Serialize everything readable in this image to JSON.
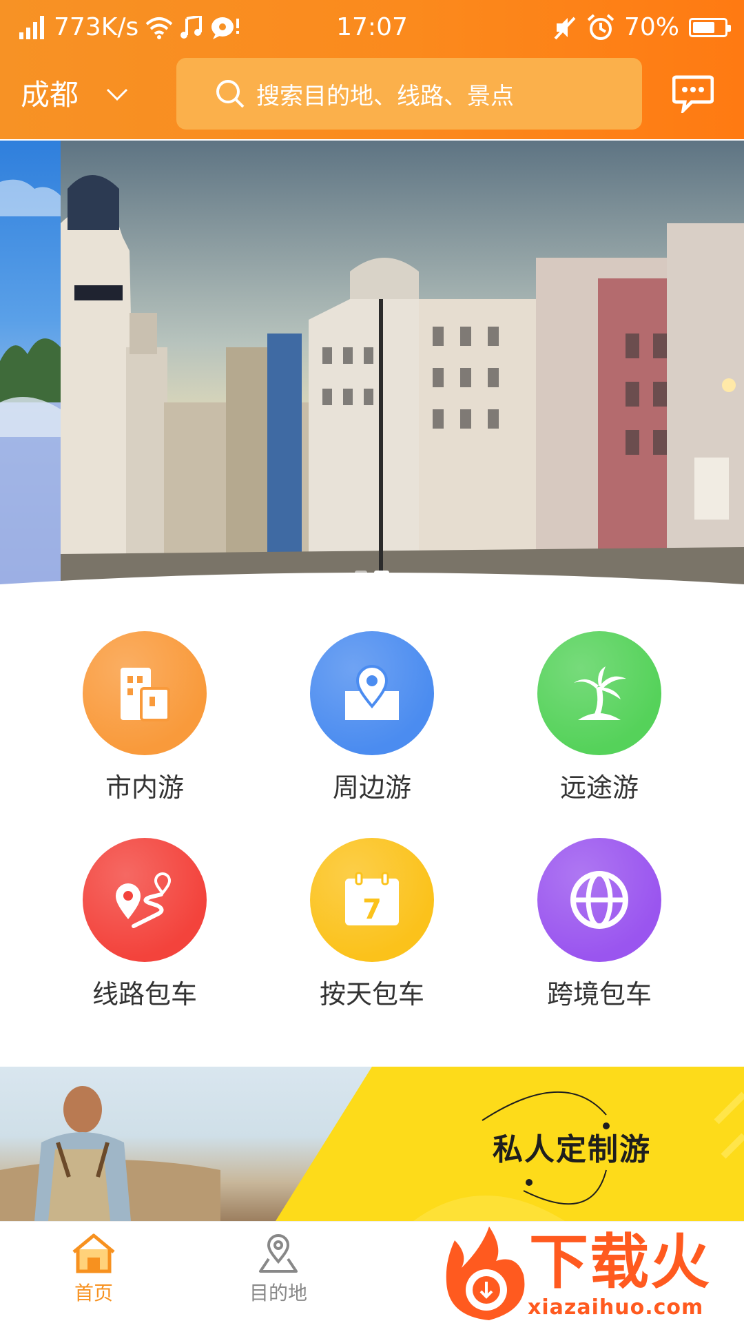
{
  "status_bar": {
    "net_speed": "773K/s",
    "time": "17:07",
    "battery": "70%",
    "battery_level": 0.7
  },
  "top_bar": {
    "city": "成都",
    "search_placeholder": "搜索目的地、线路、景点"
  },
  "banner": {
    "slide_count": 2,
    "active_slide": 1
  },
  "categories": [
    {
      "label": "市内游",
      "icon": "buildings-icon",
      "color": "#f99a3b"
    },
    {
      "label": "周边游",
      "icon": "map-pin-icon",
      "color": "#4b8cf0"
    },
    {
      "label": "远途游",
      "icon": "palm-tree-icon",
      "color": "#55d25a"
    },
    {
      "label": "线路包车",
      "icon": "route-icon",
      "color": "#f3433c"
    },
    {
      "label": "按天包车",
      "icon": "calendar-icon",
      "color": "#fbc21b"
    },
    {
      "label": "跨境包车",
      "icon": "globe-icon",
      "color": "#9a55ef"
    }
  ],
  "calendar_day": "7",
  "promo": {
    "title": "私人定制游"
  },
  "bottom_nav": [
    {
      "label": "首页",
      "icon": "home-icon",
      "active": true
    },
    {
      "label": "目的地",
      "icon": "location-icon",
      "active": false
    }
  ],
  "watermark": {
    "brand": "下载火",
    "domain": "xiazaihuo.com"
  },
  "colors": {
    "accent": "#f7911f",
    "header_end": "#ff7a12",
    "promo_yellow": "#fddb1a"
  }
}
